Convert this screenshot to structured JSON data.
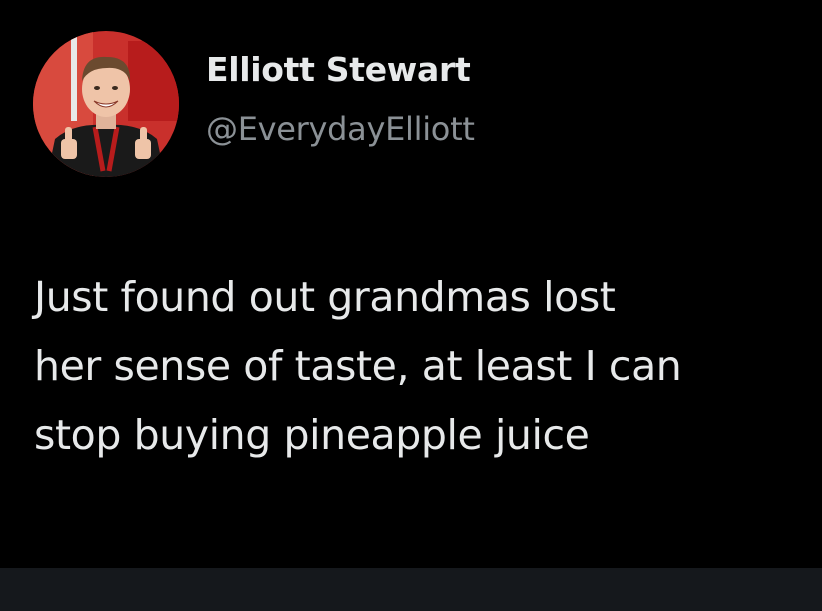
{
  "tweet": {
    "author": {
      "display_name": "Elliott Stewart",
      "handle": "@EverydayElliott",
      "avatar_icon": "profile-photo-thumbs-up"
    },
    "text_lines": [
      "Just found out grandmas lost",
      "her sense of taste, at least I can",
      "stop buying pineapple juice"
    ]
  },
  "colors": {
    "background": "#000000",
    "text_primary": "#e7e9ea",
    "text_secondary": "#8b9196",
    "avatar_bg": "#c62828",
    "bottom_bar": "#15181c"
  }
}
